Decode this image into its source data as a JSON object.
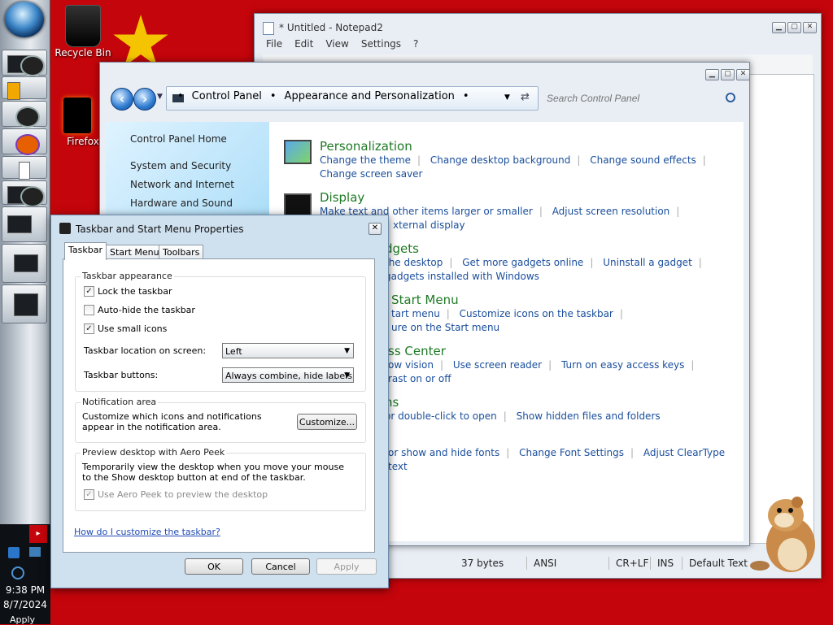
{
  "desktop": {
    "recycle_bin_label": "Recycle Bin",
    "firefox_label": "Firefox"
  },
  "taskbar": {
    "clock_time": "9:38 PM",
    "clock_date": "8/7/2024",
    "bottom_label": "Apply"
  },
  "notepad": {
    "title": "* Untitled - Notepad2",
    "menu": [
      "File",
      "Edit",
      "View",
      "Settings",
      "?"
    ],
    "status": {
      "size": "37 bytes",
      "encoding": "ANSI",
      "line_ending": "CR+LF",
      "mode": "INS",
      "scheme": "Default Text"
    }
  },
  "control_panel": {
    "breadcrumb": [
      "Control Panel",
      "Appearance and Personalization"
    ],
    "search_placeholder": "Search Control Panel",
    "left_nav": [
      "Control Panel Home",
      "System and Security",
      "Network and Internet",
      "Hardware and Sound"
    ],
    "categories": [
      {
        "title": "Personalization",
        "rows": [
          [
            "Change the theme",
            "Change desktop background",
            "Change sound effects"
          ],
          [
            "Change screen saver"
          ]
        ]
      },
      {
        "title": "Display",
        "rows": [
          [
            "Make text and other items larger or smaller",
            "Adjust screen resolution"
          ],
          [
            "xternal display"
          ]
        ]
      },
      {
        "title": "dgets",
        "rows": [
          [
            "the desktop",
            "Get more gadgets online",
            "Uninstall a gadget"
          ],
          [
            "gadgets installed with Windows"
          ]
        ]
      },
      {
        "title": "Start Menu",
        "rows": [
          [
            "tart menu",
            "Customize icons on the taskbar"
          ],
          [
            "ure on the Start menu"
          ]
        ]
      },
      {
        "title": "ss Center",
        "rows": [
          [
            "ow vision",
            "Use screen reader",
            "Turn on easy access keys"
          ],
          [
            "rast on or off"
          ]
        ]
      },
      {
        "title": "ns",
        "rows": [
          [
            "or double-click to open",
            "Show hidden files and folders"
          ]
        ]
      },
      {
        "title": "",
        "rows": [
          [
            "or show and hide fonts",
            "Change Font Settings",
            "Adjust ClearType text"
          ]
        ]
      }
    ]
  },
  "dialog": {
    "title": "Taskbar and Start Menu Properties",
    "tabs": [
      "Taskbar",
      "Start Menu",
      "Toolbars"
    ],
    "appearance_group": "Taskbar appearance",
    "lock_label": "Lock the taskbar",
    "lock_checked": true,
    "autohide_label": "Auto-hide the taskbar",
    "autohide_checked": false,
    "small_icons_label": "Use small icons",
    "small_icons_checked": true,
    "location_label": "Taskbar location on screen:",
    "location_value": "Left",
    "buttons_label": "Taskbar buttons:",
    "buttons_value": "Always combine, hide labels",
    "notification_group": "Notification area",
    "notification_text": "Customize which icons and notifications appear in the notification area.",
    "customize_button": "Customize...",
    "peek_group": "Preview desktop with Aero Peek",
    "peek_text": "Temporarily view the desktop when you move your mouse to the Show desktop button at end of the taskbar.",
    "peek_label": "Use Aero Peek to preview the desktop",
    "peek_checked": true,
    "help_link": "How do I customize the taskbar?",
    "ok": "OK",
    "cancel": "Cancel",
    "apply": "Apply"
  },
  "colors": {
    "desktop": "#c4050b",
    "link": "#1a4e9c",
    "category": "#1e7a24"
  }
}
